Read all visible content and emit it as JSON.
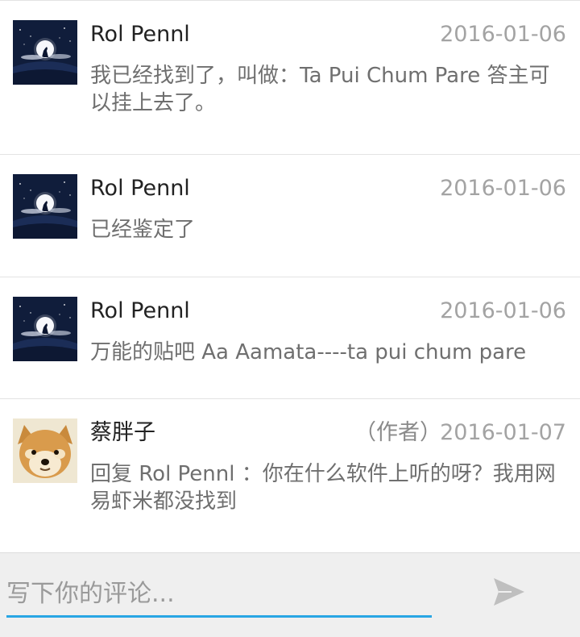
{
  "comments": [
    {
      "author": "Rol Pennl",
      "role": "",
      "date": "2016-01-06",
      "text": "我已经找到了，叫做：Ta Pui Chum Pare 答主可以挂上去了。",
      "avatar_icon": "night-wolf-moon-avatar-icon"
    },
    {
      "author": "Rol Pennl",
      "role": "",
      "date": "2016-01-06",
      "text": "已经鉴定了",
      "avatar_icon": "night-wolf-moon-avatar-icon"
    },
    {
      "author": "Rol Pennl",
      "role": "",
      "date": "2016-01-06",
      "text": "万能的贴吧 Aa Aamata----ta pui chum pare",
      "avatar_icon": "night-wolf-moon-avatar-icon"
    },
    {
      "author": "蔡胖子",
      "role": "（作者）",
      "date": "2016-01-07",
      "text": "回复 Rol Pennl ：你在什么软件上听的呀？我用网易虾米都没找到",
      "avatar_icon": "shiba-doge-avatar-icon"
    }
  ],
  "composer": {
    "placeholder": "写下你的评论...",
    "value": "",
    "send_icon": "send-arrow-icon"
  },
  "colors": {
    "accent": "#29a6e4",
    "date": "#a3a3a3",
    "text": "#6f6f6f",
    "author": "#222222",
    "composer_bg": "#efefef",
    "avatar_night": "#101d3b"
  }
}
